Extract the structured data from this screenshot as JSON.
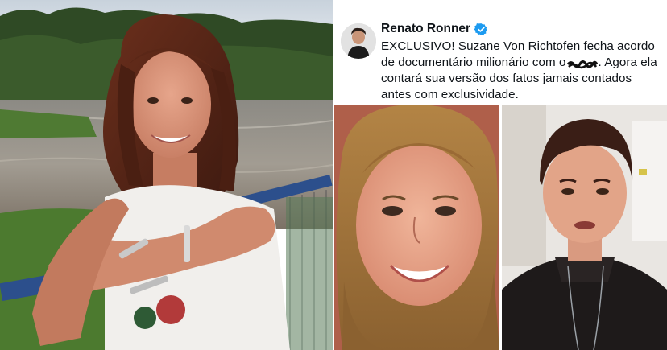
{
  "tweet": {
    "author": "Renato Ronner",
    "verified_icon": "verified-badge-icon",
    "text_part1": "EXCLUSIVO! Suzane Von Richtofen fecha acordo de documentário milionário com o",
    "text_part2": ". Agora ela contará sua versão dos fatos jamais contados antes com exclusividade."
  },
  "colors": {
    "verified_blue": "#1d9bf0",
    "text": "#0f1419"
  }
}
